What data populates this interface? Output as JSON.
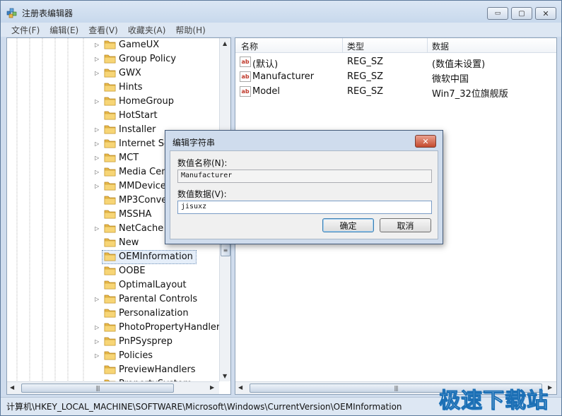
{
  "window": {
    "title": "注册表编辑器"
  },
  "controls": {
    "minimize": "▭",
    "maximize": "▢",
    "close": "✕"
  },
  "menu": [
    "文件(F)",
    "编辑(E)",
    "查看(V)",
    "收藏夹(A)",
    "帮助(H)"
  ],
  "tree": {
    "items": [
      {
        "label": "GameUX",
        "expandable": true
      },
      {
        "label": "Group Policy",
        "expandable": true
      },
      {
        "label": "GWX",
        "expandable": true
      },
      {
        "label": "Hints",
        "expandable": false
      },
      {
        "label": "HomeGroup",
        "expandable": true
      },
      {
        "label": "HotStart",
        "expandable": false
      },
      {
        "label": "Installer",
        "expandable": true
      },
      {
        "label": "Internet Settings",
        "expandable": true
      },
      {
        "label": "MCT",
        "expandable": true
      },
      {
        "label": "Media Center",
        "expandable": true
      },
      {
        "label": "MMDevices",
        "expandable": true
      },
      {
        "label": "MP3Converter",
        "expandable": false
      },
      {
        "label": "MSSHA",
        "expandable": false
      },
      {
        "label": "NetCache",
        "expandable": true
      },
      {
        "label": "New",
        "expandable": false
      },
      {
        "label": "OEMInformation",
        "expandable": false,
        "selected": true
      },
      {
        "label": "OOBE",
        "expandable": false
      },
      {
        "label": "OptimalLayout",
        "expandable": false
      },
      {
        "label": "Parental Controls",
        "expandable": true
      },
      {
        "label": "Personalization",
        "expandable": false
      },
      {
        "label": "PhotoPropertyHandler",
        "expandable": true
      },
      {
        "label": "PnPSysprep",
        "expandable": true
      },
      {
        "label": "Policies",
        "expandable": true
      },
      {
        "label": "PreviewHandlers",
        "expandable": false
      },
      {
        "label": "PropertySystem",
        "expandable": true
      }
    ]
  },
  "list": {
    "columns": [
      "名称",
      "类型",
      "数据"
    ],
    "rows": [
      {
        "name": "(默认)",
        "type": "REG_SZ",
        "data": "(数值未设置)"
      },
      {
        "name": "Manufacturer",
        "type": "REG_SZ",
        "data": "微软中国"
      },
      {
        "name": "Model",
        "type": "REG_SZ",
        "data": "Win7_32位旗舰版"
      }
    ]
  },
  "icons": {
    "value_icon": "ab"
  },
  "dialog": {
    "title": "编辑字符串",
    "name_label": "数值名称(N):",
    "name_value": "Manufacturer",
    "data_label": "数值数据(V):",
    "data_value": "jisuxz",
    "ok_label": "确定",
    "cancel_label": "取消"
  },
  "status": {
    "path": "计算机\\HKEY_LOCAL_MACHINE\\SOFTWARE\\Microsoft\\Windows\\CurrentVersion\\OEMInformation"
  },
  "watermark": "极速下载站",
  "colors": {
    "accent": "#1b6fb5",
    "frame": "#cfdced",
    "close_red": "#c44a2e"
  }
}
